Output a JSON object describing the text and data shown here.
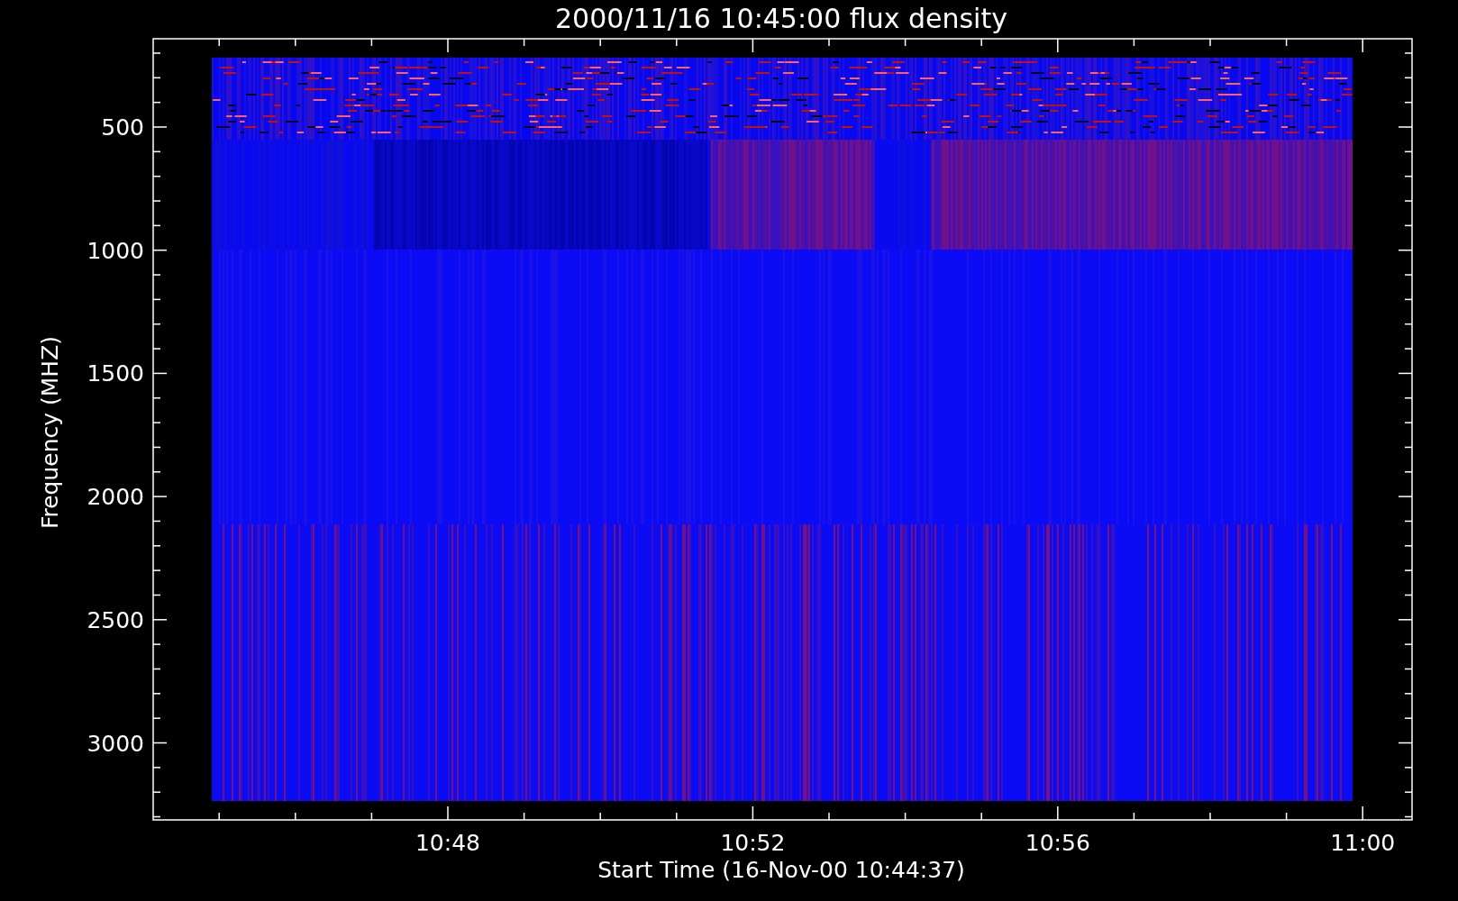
{
  "title": "2000/11/16 10:45:00 flux density",
  "y_axis": {
    "label": "Frequency (MHZ)",
    "ticks": [
      "500",
      "1000",
      "1500",
      "2000",
      "2500",
      "3000"
    ]
  },
  "x_axis": {
    "label": "Start Time (16-Nov-00 10:44:37)",
    "ticks": [
      "10:48",
      "10:52",
      "10:56",
      "11:00"
    ]
  }
}
